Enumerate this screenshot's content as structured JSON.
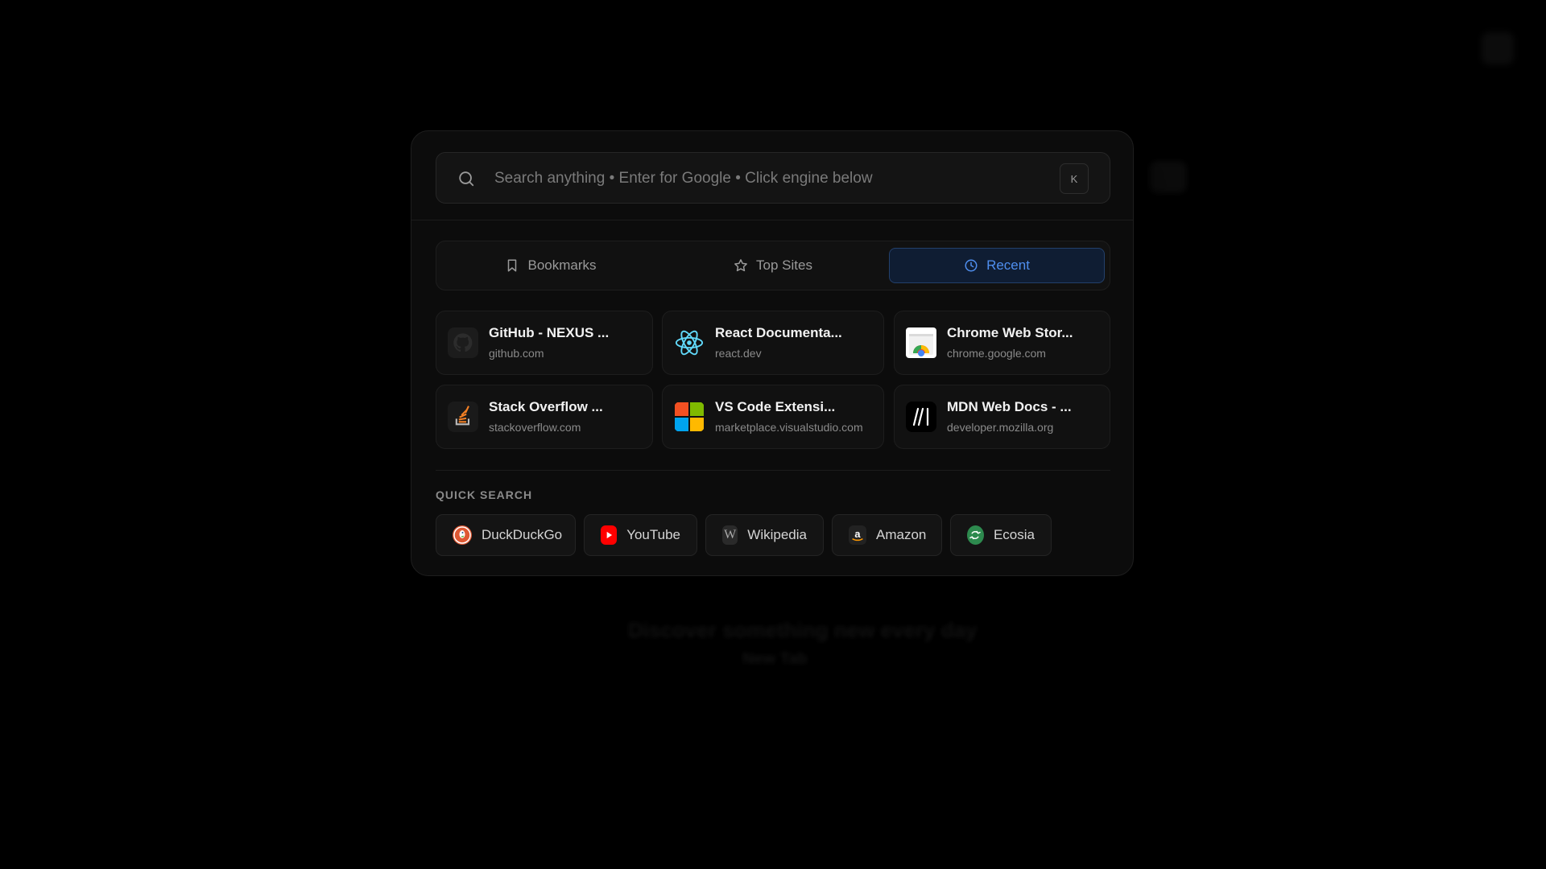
{
  "background": {
    "ghost_line_1": "Discover something new every day",
    "ghost_line_2": "New Tab"
  },
  "search": {
    "placeholder": "Search anything • Enter for Google • Click engine below",
    "value": "",
    "shortcut_key": "K"
  },
  "tabs": [
    {
      "label": "Bookmarks",
      "icon": "bookmark-icon",
      "active": false
    },
    {
      "label": "Top Sites",
      "icon": "star-icon",
      "active": false
    },
    {
      "label": "Recent",
      "icon": "clock-icon",
      "active": true
    }
  ],
  "recent_sites": [
    {
      "title": "GitHub - NEXUS ...",
      "domain": "github.com",
      "icon": "github-icon"
    },
    {
      "title": "React Documenta...",
      "domain": "react.dev",
      "icon": "react-icon"
    },
    {
      "title": "Chrome Web Stor...",
      "domain": "chrome.google.com",
      "icon": "chrome-web-store-icon"
    },
    {
      "title": "Stack Overflow ...",
      "domain": "stackoverflow.com",
      "icon": "stackoverflow-icon"
    },
    {
      "title": "VS Code Extensi...",
      "domain": "marketplace.visualstudio.com",
      "icon": "microsoft-icon"
    },
    {
      "title": "MDN Web Docs - ...",
      "domain": "developer.mozilla.org",
      "icon": "mdn-icon"
    }
  ],
  "quick_search": {
    "label": "QUICK SEARCH",
    "engines": [
      {
        "label": "DuckDuckGo",
        "icon": "duckduckgo-icon"
      },
      {
        "label": "YouTube",
        "icon": "youtube-icon"
      },
      {
        "label": "Wikipedia",
        "icon": "wikipedia-icon"
      },
      {
        "label": "Amazon",
        "icon": "amazon-icon"
      },
      {
        "label": "Ecosia",
        "icon": "ecosia-icon"
      }
    ]
  },
  "colors": {
    "accent": "#4f8ff0",
    "background": "#000000",
    "panel": "#0c0c0c"
  }
}
